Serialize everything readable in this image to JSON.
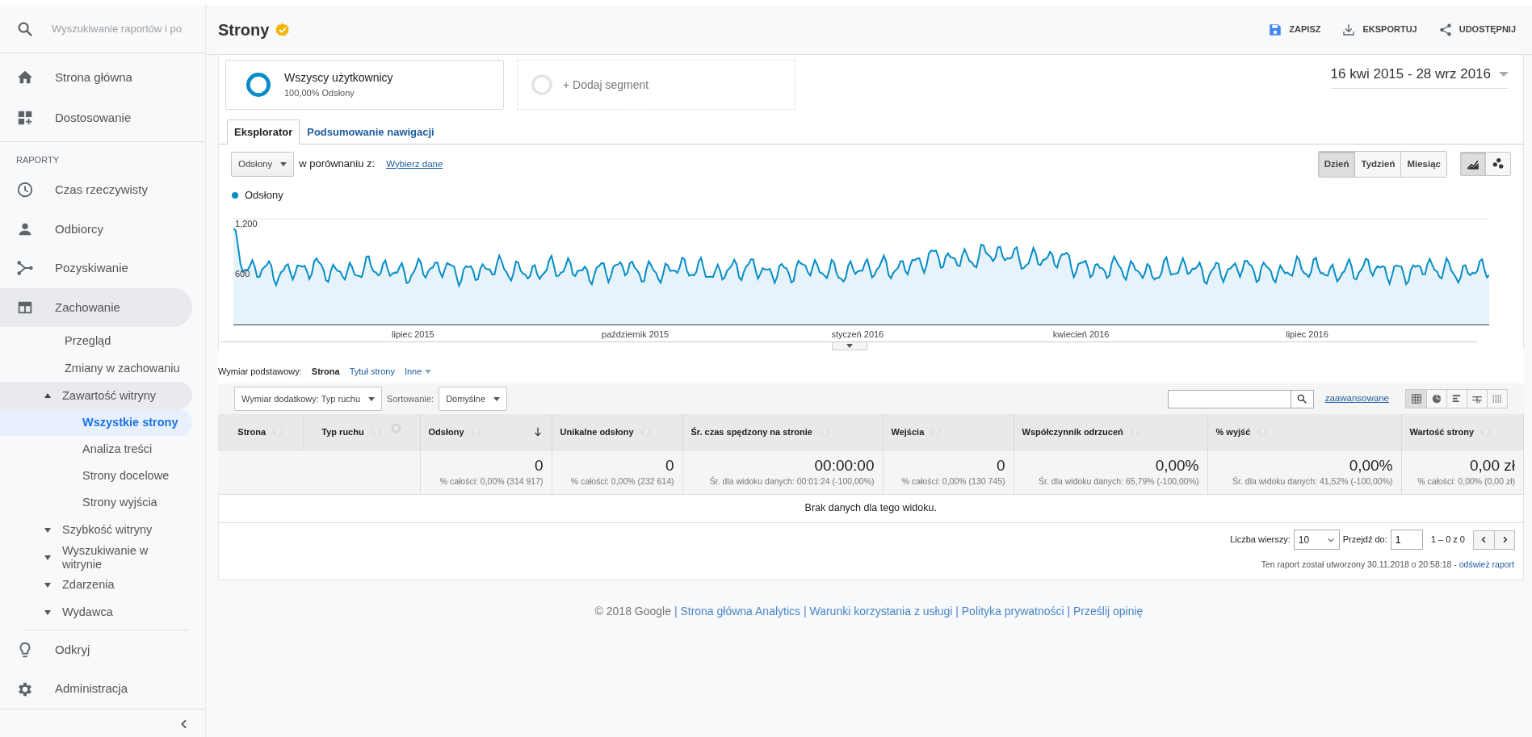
{
  "sidebar": {
    "search": {
      "placeholder": "Wyszukiwanie raportów i po"
    },
    "top_items": [
      {
        "label": "Strona główna",
        "selected": false
      },
      {
        "label": "Dostosowanie",
        "selected": false
      }
    ],
    "section_label": "RAPORTY",
    "report_items": [
      {
        "label": "Czas rzeczywisty",
        "expanded": false,
        "selected": false
      },
      {
        "label": "Odbiorcy",
        "expanded": false,
        "selected": false
      },
      {
        "label": "Pozyskiwanie",
        "expanded": false,
        "selected": false
      },
      {
        "label": "Zachowanie",
        "expanded": true,
        "selected": false,
        "children": [
          {
            "label": "Przegląd",
            "kind": "link",
            "selected": false
          },
          {
            "label": "Zmiany w zachowaniu",
            "kind": "link",
            "selected": false
          },
          {
            "label": "Zawartość witryny",
            "kind": "folder",
            "expanded": true,
            "selected": false,
            "children": [
              {
                "label": "Wszystkie strony",
                "selected": true
              },
              {
                "label": "Analiza treści",
                "selected": false
              },
              {
                "label": "Strony docelowe",
                "selected": false
              },
              {
                "label": "Strony wyjścia",
                "selected": false
              }
            ]
          },
          {
            "label": "Szybkość witryny",
            "kind": "folder",
            "expanded": false,
            "selected": false
          },
          {
            "label": "Wyszukiwanie w witrynie",
            "kind": "folder",
            "expanded": false,
            "selected": false
          },
          {
            "label": "Zdarzenia",
            "kind": "folder",
            "expanded": false,
            "selected": false
          },
          {
            "label": "Wydawca",
            "kind": "folder",
            "expanded": false,
            "selected": false
          }
        ]
      }
    ],
    "bottom_items": [
      {
        "label": "Odkryj",
        "selected": false
      },
      {
        "label": "Administracja",
        "selected": false
      }
    ]
  },
  "header": {
    "title": "Strony",
    "actions": [
      {
        "label": "ZAPISZ"
      },
      {
        "label": "EKSPORTUJ"
      },
      {
        "label": "UDOSTĘPNIJ"
      }
    ]
  },
  "segments": [
    {
      "title": "Wszyscy użytkownicy",
      "subtitle": "100,00% Odsłony"
    }
  ],
  "add_segment": "+ Dodaj segment",
  "date_range": "16 kwi 2015 - 28 wrz 2016",
  "tabs": [
    {
      "label": "Eksplorator",
      "selected": true
    },
    {
      "label": "Podsumowanie nawigacji",
      "selected": false
    }
  ],
  "chart_controls": {
    "metric": "Odsłony",
    "compare_label": "w porównaniu z:",
    "compare_link": "Wybierz dane",
    "periods": [
      {
        "label": "Dzień",
        "selected": true
      },
      {
        "label": "Tydzień",
        "selected": false
      },
      {
        "label": "Miesiąc",
        "selected": false
      }
    ],
    "chart_types": [
      {
        "selected": true
      },
      {
        "selected": false
      }
    ]
  },
  "chart": {
    "legend": {
      "label": "Odsłony",
      "color": "#058dc7"
    },
    "y_labels": [
      "1,200",
      "600"
    ],
    "x_labels": [
      "lipiec 2015",
      "październik 2015",
      "styczeń 2016",
      "kwiecień 2016",
      "lipiec 2016"
    ]
  },
  "dimensions": {
    "label": "Wymiar podstawowy:",
    "options": [
      {
        "label": "Strona",
        "selected": true
      },
      {
        "label": "Tytuł strony",
        "selected": false
      }
    ],
    "more": "Inne"
  },
  "toolbar": {
    "secondary": "Wymiar dodatkowy: Typ ruchu",
    "sort_label": "Sortowanie:",
    "sort_value": "Domyślne",
    "advanced": "zaawansowane",
    "views": [
      {
        "selected": true
      },
      {
        "selected": false
      },
      {
        "selected": false
      },
      {
        "selected": false
      },
      {
        "selected": false
      }
    ]
  },
  "table": {
    "columns": [
      {
        "label": "Strona",
        "kind": "dimension"
      },
      {
        "label": "Typ ruchu",
        "kind": "dimension",
        "removable": true
      },
      {
        "label": "Odsłony",
        "kind": "metric",
        "sorted": true
      },
      {
        "label": "Unikalne odsłony",
        "kind": "metric"
      },
      {
        "label": "Śr. czas spędzony na stronie",
        "kind": "metric"
      },
      {
        "label": "Wejścia",
        "kind": "metric"
      },
      {
        "label": "Współczynnik odrzuceń",
        "kind": "metric"
      },
      {
        "label": "% wyjść",
        "kind": "metric"
      },
      {
        "label": "Wartość strony",
        "kind": "metric"
      }
    ],
    "totals": [
      {
        "value": "0",
        "note": "% całości: 0,00% (314 917)"
      },
      {
        "value": "0",
        "note": "% całości: 0,00% (232 614)"
      },
      {
        "value": "00:00:00",
        "note": "Śr. dla widoku danych: 00:01:24 (-100,00%)"
      },
      {
        "value": "0",
        "note": "% całości: 0,00% (130 745)"
      },
      {
        "value": "0,00%",
        "note": "Śr. dla widoku danych: 65,79% (-100,00%)"
      },
      {
        "value": "0,00%",
        "note": "Śr. dla widoku danych: 41,52% (-100,00%)"
      },
      {
        "value": "0,00 zł",
        "note": "% całości: 0,00% (0,00 zł)"
      }
    ],
    "empty_message": "Brak danych dla tego widoku."
  },
  "pagination": {
    "rows_label": "Liczba wierszy:",
    "rows_value": "10",
    "goto_label": "Przejdź do:",
    "goto_value": "1",
    "range": "1 – 0 z 0"
  },
  "report_note": {
    "text": "Ten raport został utworzony 30.11.2018 o 20:58:18 - ",
    "link": "odśwież raport"
  },
  "footer": {
    "copyright": "© 2018 Google",
    "separators": [
      "|",
      "|",
      "|",
      "|"
    ],
    "links": [
      "Strona główna Analytics",
      "Warunki korzystania z usługi",
      "Polityka prywatności",
      "Prześlij opinię"
    ]
  }
}
